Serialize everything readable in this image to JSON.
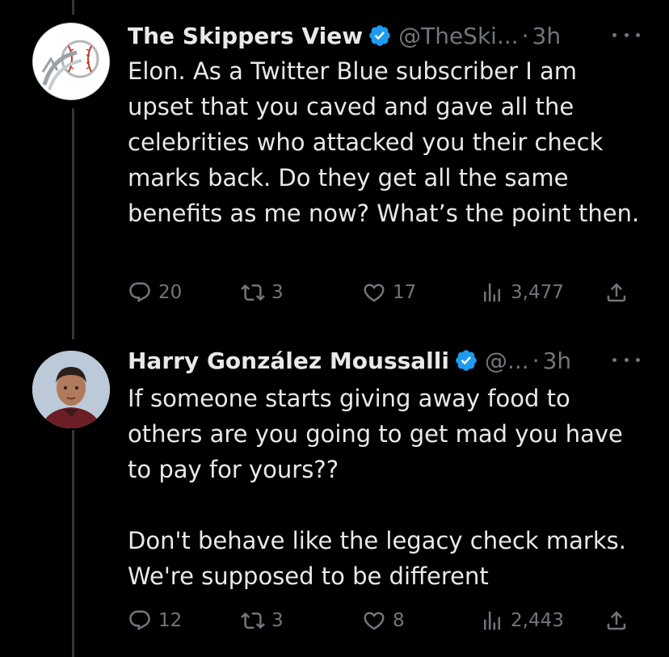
{
  "colors": {
    "background": "#000000",
    "text": "#e7e9ea",
    "muted": "#71767b",
    "verified": "#1d9bf0",
    "thread_line": "#333639"
  },
  "tweets": [
    {
      "name": "The Skippers View",
      "handle": "@TheSki...",
      "dot": "·",
      "time": "3h",
      "text": "Elon. As a Twitter Blue subscriber I am upset that you caved and gave all the celebrities who attacked you their check marks back. Do they get all the same benefits as me now? What’s the point then.",
      "replies": "20",
      "retweets": "3",
      "likes": "17",
      "views": "3,477",
      "avatar_icon": "baseball-logo-icon"
    },
    {
      "name": "Harry González Moussalli",
      "handle": "@...",
      "dot": "·",
      "time": "3h",
      "text": "If someone starts giving away food to others are you going to get mad you have to pay for yours??\n\nDon't behave like the legacy check marks. We're supposed to be different",
      "replies": "12",
      "retweets": "3",
      "likes": "8",
      "views": "2,443",
      "avatar_icon": "profile-photo-avatar"
    }
  ]
}
